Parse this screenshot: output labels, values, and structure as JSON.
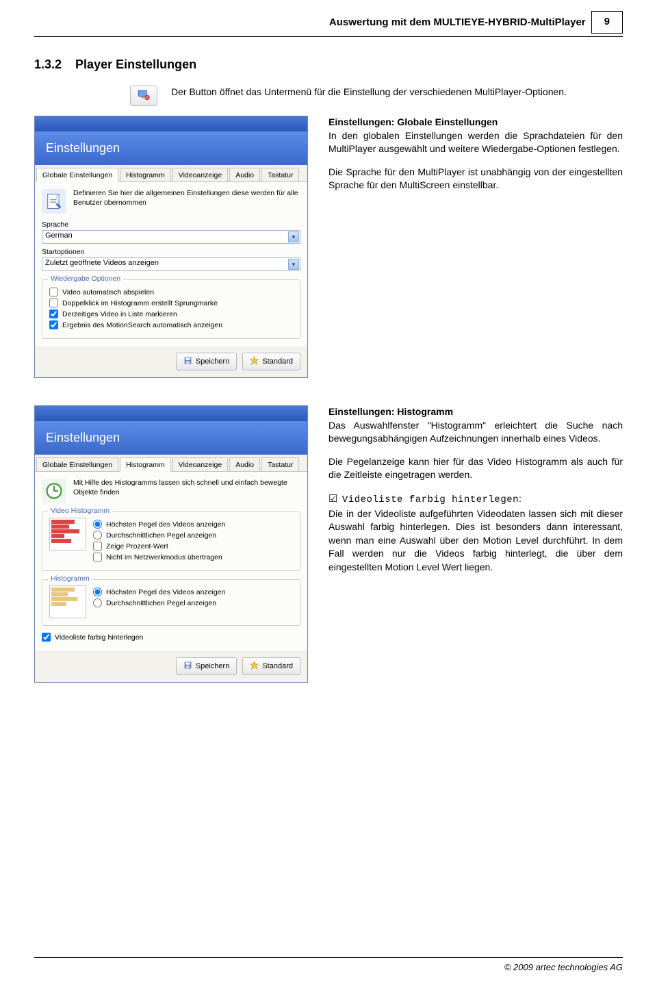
{
  "header": {
    "title": "Auswertung mit dem MULTIEYE-HYBRID-MultiPlayer",
    "page_number": "9"
  },
  "section": {
    "number": "1.3.2",
    "title": "Player Einstellungen"
  },
  "intro": "Der Button öffnet das Untermenü für die Einstellung der verschiedenen MultiPlayer-Optionen.",
  "dialog1": {
    "banner": "Einstellungen",
    "tabs": [
      "Globale Einstellungen",
      "Histogramm",
      "Videoanzeige",
      "Audio",
      "Tastatur"
    ],
    "active_tab": 0,
    "desc": "Definieren Sie hier die allgemeinen Einstellungen diese werden für alle Benutzer übernommen",
    "lang_label": "Sprache",
    "lang_value": "German",
    "start_label": "Startoptionen",
    "start_value": "Zuletzt geöffnete Videos anzeigen",
    "group_title": "Wiedergabe Optionen",
    "opts": [
      {
        "label": "Video automatisch abspielen",
        "checked": false
      },
      {
        "label": "Doppelklick im Histogramm erstellt Sprungmarke",
        "checked": false
      },
      {
        "label": "Derzeitiges Video in Liste markieren",
        "checked": true
      },
      {
        "label": "Ergebnis des MotionSearch automatisch anzeigen",
        "checked": true
      }
    ],
    "btn_save": "Speichern",
    "btn_std": "Standard"
  },
  "text1": {
    "h": "Einstellungen: Globale Einstellungen",
    "p1": "In den globalen Einstellungen werden die Sprachdateien für den MultiPlayer ausgewählt und weitere Wiedergabe-Optionen festlegen.",
    "p2": "Die Sprache für den MultiPlayer ist unabhängig von der eingestellten Sprache für den MultiScreen einstellbar."
  },
  "dialog2": {
    "banner": "Einstellungen",
    "tabs": [
      "Globale Einstellungen",
      "Histogramm",
      "Videoanzeige",
      "Audio",
      "Tastatur"
    ],
    "active_tab": 1,
    "desc": "Mit Hilfe des Histogramms lassen sich schnell und einfach bewegte Objekte finden",
    "group1_title": "Video Histogramm",
    "group1_opts": [
      {
        "type": "radio",
        "label": "Höchsten Pegel des Videos anzeigen",
        "checked": true
      },
      {
        "type": "radio",
        "label": "Durchschnittlichen Pegel anzeigen",
        "checked": false
      },
      {
        "type": "check",
        "label": "Zeige Prozent-Wert",
        "checked": false
      },
      {
        "type": "check",
        "label": "Nicht im Netzwerkmodus übertragen",
        "checked": false
      }
    ],
    "group2_title": "Histogramm",
    "group2_opts": [
      {
        "type": "radio",
        "label": "Höchsten Pegel des Videos anzeigen",
        "checked": true
      },
      {
        "type": "radio",
        "label": "Durchschnittlichen Pegel anzeigen",
        "checked": false
      }
    ],
    "bottom_check": {
      "label": "Videoliste farbig hinterlegen",
      "checked": true
    },
    "btn_save": "Speichern",
    "btn_std": "Standard"
  },
  "text2": {
    "h": "Einstellungen: Histogramm",
    "p1": "Das Auswahlfenster \"Histogramm\" erleichtert die Suche nach bewegungsabhängigen Aufzeichnungen innerhalb eines Videos.",
    "p2": "Die Pegelanzeige kann hier für das Video Histogramm als auch für die Zeitleiste eingetragen werden.",
    "tip_label": "Videoliste farbig hinterlegen",
    "p3": "Die in der Videoliste aufgeführten Videodaten lassen sich mit dieser Auswahl farbig hinterlegen. Dies ist besonders dann interessant, wenn man eine Auswahl über den Motion Level durchführt. In dem Fall werden nur die Videos farbig hinterlegt, die über dem eingestellten Motion Level Wert liegen."
  },
  "footer": "© 2009 artec technologies AG"
}
